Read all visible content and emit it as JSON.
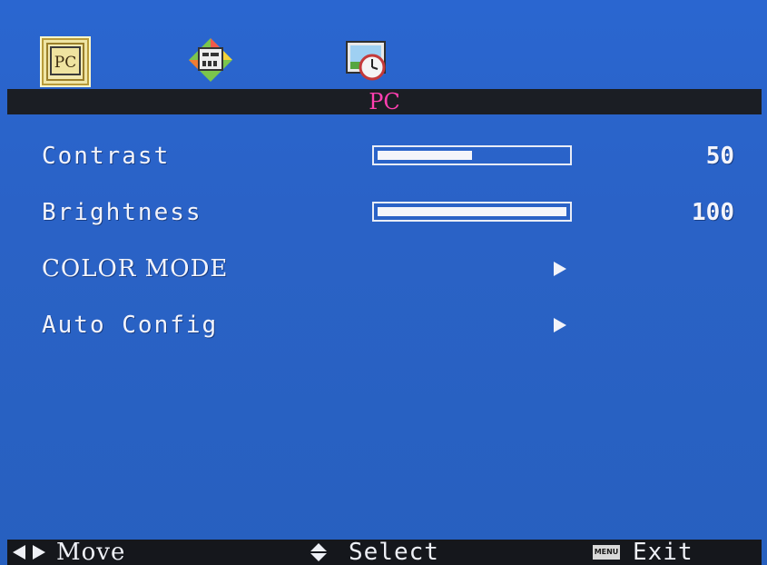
{
  "tabs": [
    {
      "label": "PC",
      "icon": "pc-tab-icon",
      "active": true
    },
    {
      "label": "",
      "icon": "image-adjust-tab-icon",
      "active": false
    },
    {
      "label": "",
      "icon": "clock-timer-tab-icon",
      "active": false
    }
  ],
  "title": "PC",
  "menu": [
    {
      "label": "Contrast",
      "value": "50",
      "level": 0.5
    },
    {
      "label": "Brightness",
      "value": "100",
      "level": 1.0
    },
    {
      "label": "COLOR MODE",
      "arrow": "submenu-arrow-icon"
    },
    {
      "label": "Auto Config",
      "arrow": "submenu-arrow-icon"
    }
  ],
  "footer": {
    "move": "Move",
    "select": "Select",
    "menu_key": "MENU",
    "exit": "Exit"
  },
  "colors": {
    "background": "#2a62c4",
    "title_text": "#ff3fb0",
    "bar_fill": "#f4f5fa",
    "active_tab": "#efe5a4"
  }
}
